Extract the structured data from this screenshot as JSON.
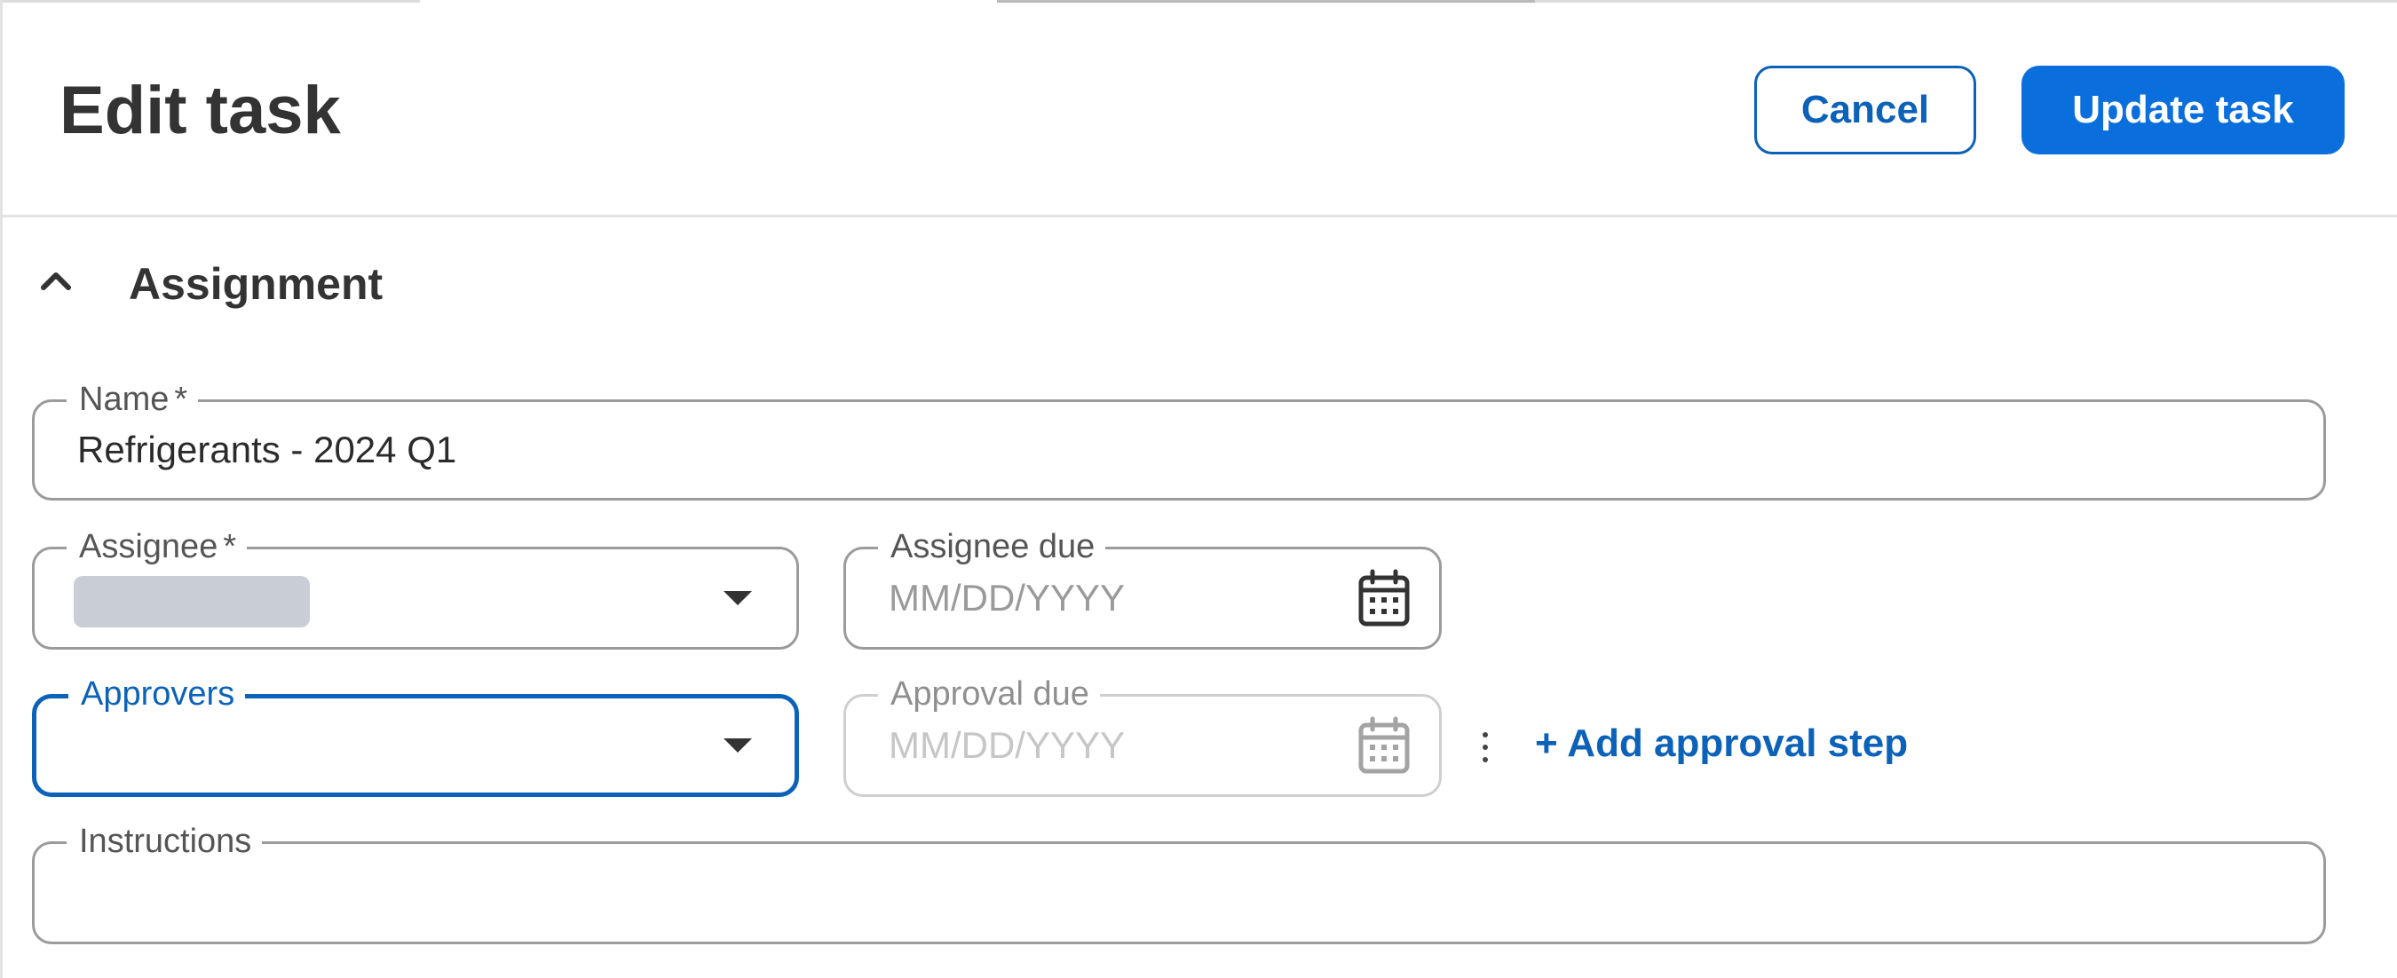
{
  "header": {
    "title": "Edit task",
    "cancel_label": "Cancel",
    "update_label": "Update task"
  },
  "section": {
    "title": "Assignment",
    "expanded": true,
    "toggle_icon": "chevron-up-icon"
  },
  "fields": {
    "name": {
      "label": "Name",
      "required_mark": "*",
      "value": "Refrigerants - 2024 Q1"
    },
    "assignee": {
      "label": "Assignee",
      "required_mark": "*",
      "value_redacted": true
    },
    "assignee_due": {
      "label": "Assignee due",
      "placeholder": "MM/DD/YYYY",
      "icon": "calendar-icon"
    },
    "approvers": {
      "label": "Approvers",
      "focused": true
    },
    "approval_due": {
      "label": "Approval due",
      "placeholder": "MM/DD/YYYY",
      "icon": "calendar-icon",
      "disabled": true
    },
    "instructions": {
      "label": "Instructions",
      "value": ""
    }
  },
  "actions": {
    "more_icon": "kebab-menu-icon",
    "add_approval_step": "+ Add approval step"
  },
  "colors": {
    "primary": "#0a6fdc",
    "link": "#0b62b8",
    "text": "#333333",
    "border": "#9b9b9b"
  }
}
